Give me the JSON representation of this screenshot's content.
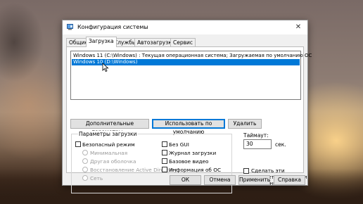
{
  "window": {
    "title": "Конфигурация системы",
    "close_glyph": "✕"
  },
  "tabs": [
    {
      "label": "Общие"
    },
    {
      "label": "Загрузка"
    },
    {
      "label": "Службы"
    },
    {
      "label": "Автозагрузка"
    },
    {
      "label": "Сервис"
    }
  ],
  "os_list": [
    {
      "text": "Windows 11 (C:\\Windows) : Текущая операционная система; Загружаемая по умолчанию ОС",
      "selected": false
    },
    {
      "text": "Windows 10 (D:\\Windows)",
      "selected": true
    }
  ],
  "actions": {
    "advanced": "Дополнительные параметры...",
    "set_default": "Использовать по умолчанию",
    "delete": "Удалить"
  },
  "boot_options": {
    "label": "Параметры загрузки",
    "safe_boot": "Безопасный режим",
    "minimal": "Минимальная",
    "alt_shell": "Другая оболочка",
    "ad_repair": "Восстановление Active Directory",
    "network": "Сеть",
    "no_gui": "Без GUI",
    "boot_log": "Журнал загрузки",
    "base_video": "Базовое видео",
    "os_info": "Информация  об ОС"
  },
  "timeout": {
    "label": "Таймаут:",
    "value": "30",
    "unit": "сек."
  },
  "persist": "Сделать эти параметры загрузки постоянными",
  "footer": {
    "ok": "ОК",
    "cancel": "Отмена",
    "apply": "Применить",
    "help": "Справка"
  },
  "colors": {
    "selection": "#0078d7",
    "accent_border": "#0078d7"
  }
}
